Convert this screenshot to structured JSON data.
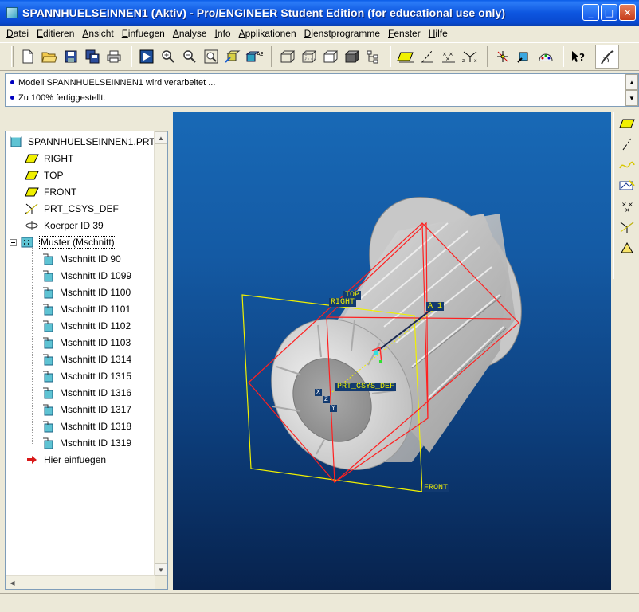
{
  "window": {
    "title": "SPANNHUELSEINNEN1 (Aktiv) - Pro/ENGINEER Student Edition (for educational use only)",
    "minimize": "_",
    "maximize": "□",
    "close": "✕"
  },
  "menu": {
    "items": [
      {
        "u": "D",
        "rest": "atei"
      },
      {
        "u": "E",
        "rest": "ditieren"
      },
      {
        "u": "A",
        "rest": "nsicht"
      },
      {
        "u": "E",
        "rest": "infuegen"
      },
      {
        "u": "A",
        "rest": "nalyse"
      },
      {
        "u": "I",
        "rest": "nfo"
      },
      {
        "u": "A",
        "rest": "pplikationen"
      },
      {
        "u": "D",
        "rest": "ienstprogramme"
      },
      {
        "u": "F",
        "rest": "enster"
      },
      {
        "u": "H",
        "rest": "ilfe"
      }
    ]
  },
  "toolbar": {
    "icons": [
      "new-file-icon",
      "open-folder-icon",
      "save-icon",
      "save-copy-icon",
      "print-icon",
      "sep",
      "repaint-icon",
      "zoom-in-icon",
      "zoom-out-icon",
      "refit-icon",
      "orient-icon",
      "saved-views-icon",
      "sep",
      "wireframe-icon",
      "hidden-line-icon",
      "no-hidden-icon",
      "shading-icon",
      "model-tree-icon",
      "sep",
      "datum-planes-icon",
      "datum-axes-icon",
      "datum-points-icon",
      "coordinate-systems-icon",
      "sep",
      "spin-center-icon",
      "zoom-box-icon",
      "appearance-icon",
      "sep",
      "context-help-icon"
    ]
  },
  "messages": [
    "Modell SPANNHUELSEINNEN1 wird verarbeitet ...",
    "Zu 100% fertiggestellt."
  ],
  "tree": {
    "root": "SPANNHUELSEINNEN1.PRT",
    "datums": [
      "RIGHT",
      "TOP",
      "FRONT"
    ],
    "csys": "PRT_CSYS_DEF",
    "body": "Koerper ID 39",
    "pattern": "Muster (Mschnitt)",
    "cuts": [
      "Mschnitt ID 90",
      "Mschnitt ID 1099",
      "Mschnitt ID 1100",
      "Mschnitt ID 1101",
      "Mschnitt ID 1102",
      "Mschnitt ID 1103",
      "Mschnitt ID 1314",
      "Mschnitt ID 1315",
      "Mschnitt ID 1316",
      "Mschnitt ID 1317",
      "Mschnitt ID 1318",
      "Mschnitt ID 1319"
    ],
    "insert_here": "Hier einfuegen"
  },
  "viewport": {
    "labels": {
      "top": "TOP",
      "right": "RIGHT",
      "front": "FRONT",
      "axis": "A_1",
      "csys": "PRT_CSYS_DEF",
      "x": "X",
      "z": "Z",
      "y": "Y"
    },
    "colors": {
      "datum_right_front": "#ff2020",
      "datum_front": "#f0f000",
      "label_bg": "#123a70",
      "label_fg": "#f0f000"
    }
  },
  "right_toolbar": {
    "icons": [
      "datum-plane-tool-icon",
      "datum-axis-tool-icon",
      "datum-curve-tool-icon",
      "sketch-tool-icon",
      "datum-point-tool-icon",
      "csys-tool-icon",
      "analysis-tool-icon"
    ]
  }
}
